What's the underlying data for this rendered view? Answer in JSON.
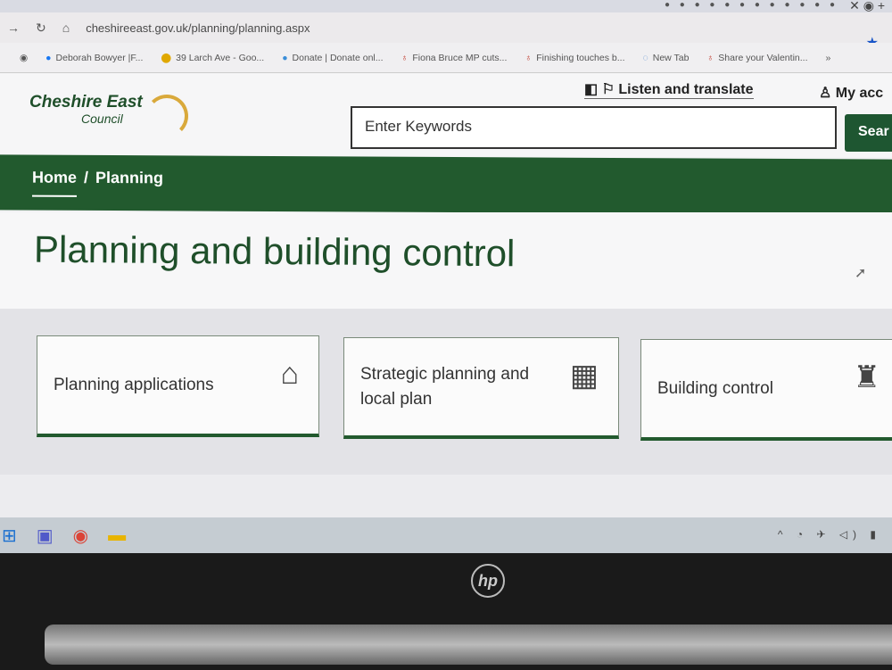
{
  "browser": {
    "url": "cheshireeast.gov.uk/planning/planning.aspx",
    "bookmarks": [
      {
        "label": "Deborah Bowyer |F...",
        "icon": "facebook-icon"
      },
      {
        "label": "39 Larch Ave - Goo...",
        "icon": "map-pin-icon"
      },
      {
        "label": "Donate | Donate onl...",
        "icon": "globe-icon"
      },
      {
        "label": "Fiona Bruce MP cuts...",
        "icon": "news-icon"
      },
      {
        "label": "Finishing touches b...",
        "icon": "news-icon"
      },
      {
        "label": "New Tab",
        "icon": "new-tab-icon"
      },
      {
        "label": "Share your Valentin...",
        "icon": "news-icon"
      }
    ],
    "more": "»"
  },
  "header": {
    "logo_line1": "Cheshire East",
    "logo_line2": "Council",
    "listen": "Listen and translate",
    "account": "My acc",
    "search_placeholder": "Enter Keywords",
    "search_button": "Sear"
  },
  "breadcrumb": {
    "home": "Home",
    "sep": "/",
    "current": "Planning"
  },
  "page": {
    "title": "Planning and building control"
  },
  "cards": [
    {
      "label": "Planning applications",
      "icon": "house-check-icon"
    },
    {
      "label": "Strategic planning and local plan",
      "icon": "map-location-icon"
    },
    {
      "label": "Building control",
      "icon": "hard-hat-icon"
    }
  ],
  "colors": {
    "brand_green": "#225a2e",
    "logo_gold": "#d9a93b"
  },
  "laptop": {
    "brand": "hp"
  }
}
